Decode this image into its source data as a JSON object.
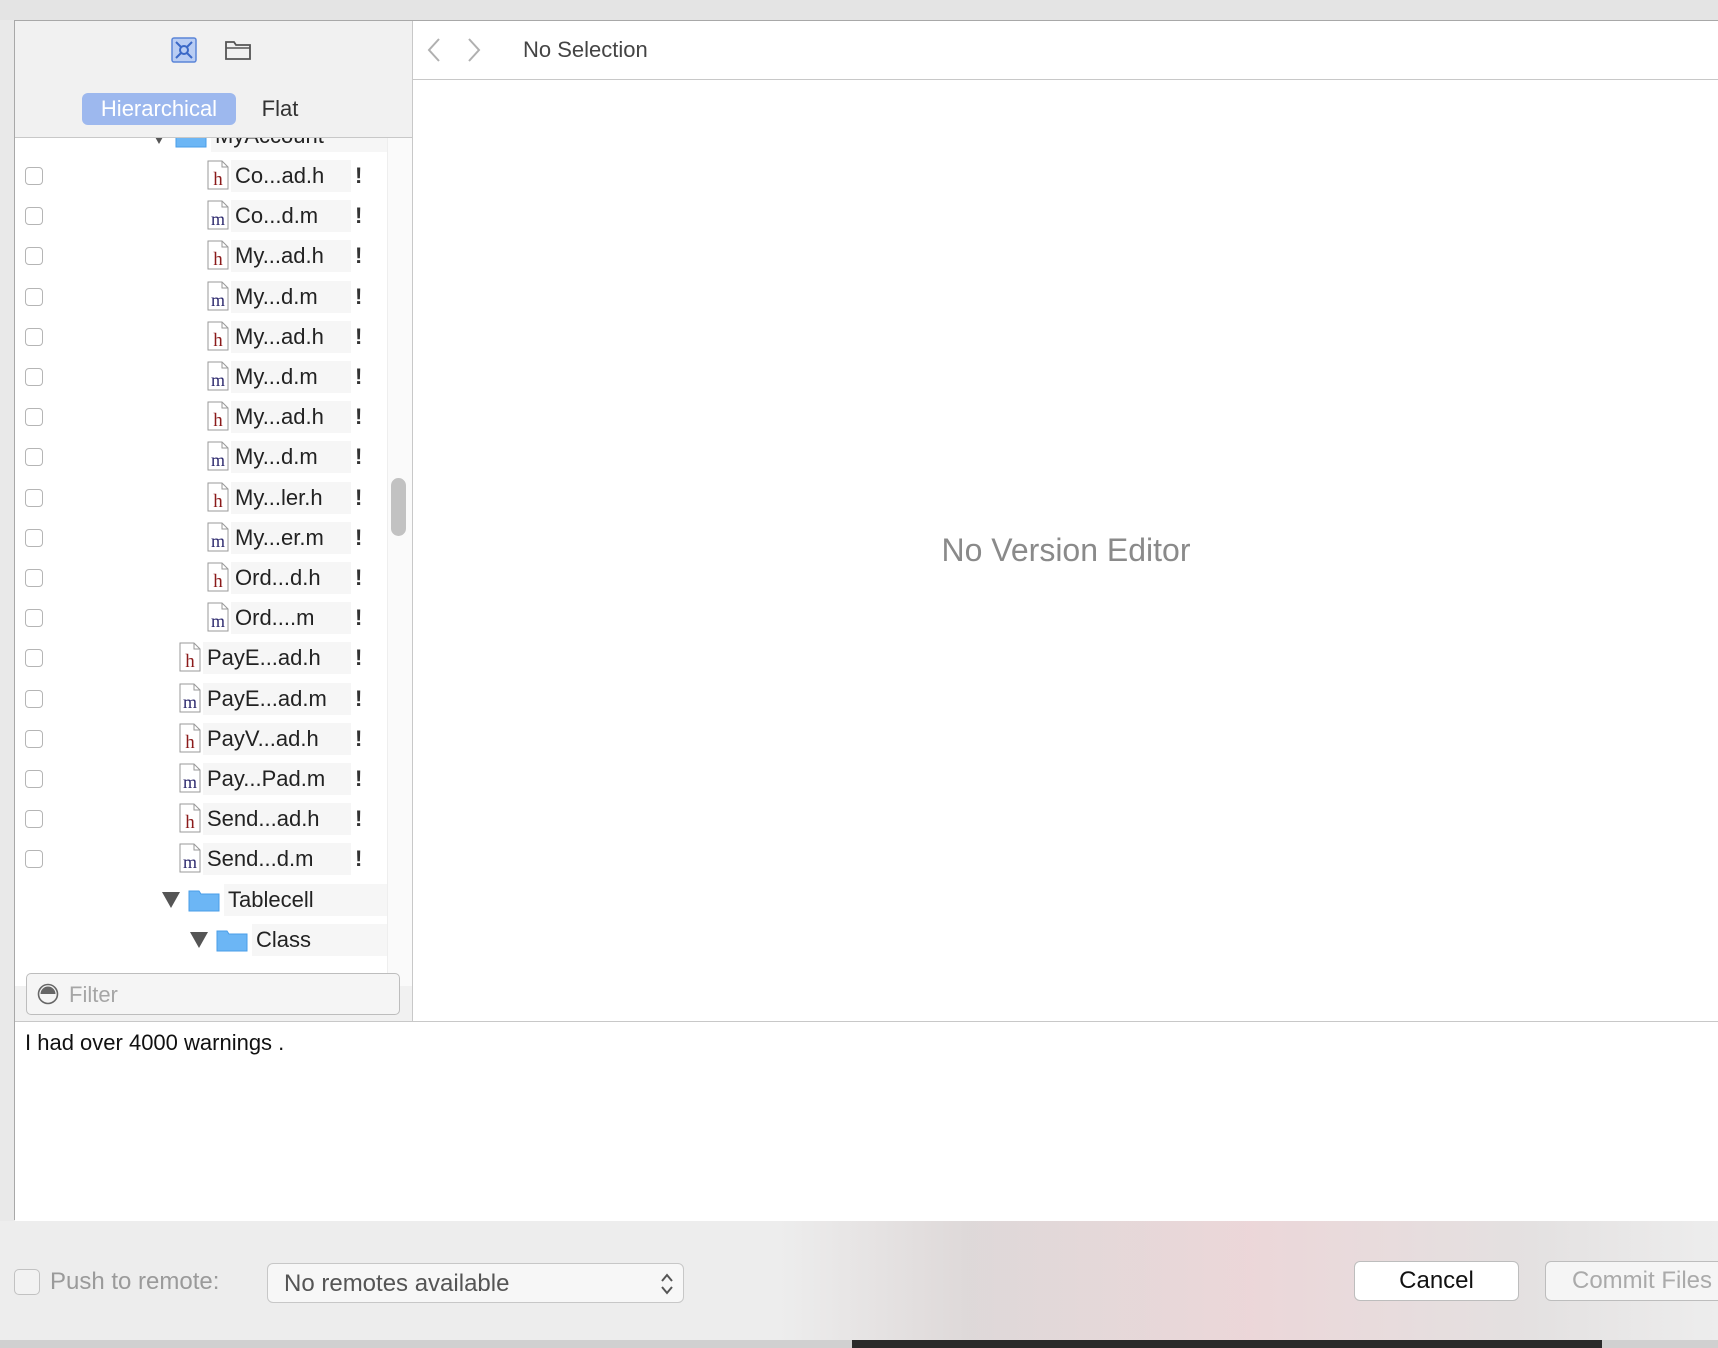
{
  "sidebar": {
    "toolbar": {
      "icon_a": "source-control-icon",
      "icon_b": "folder-icon"
    },
    "segments": [
      "Hierarchical",
      "Flat"
    ],
    "active_segment": "Hierarchical",
    "top_folder": "MyAccount",
    "files": [
      {
        "type": "h",
        "name": "Co...ad.h",
        "level": 3
      },
      {
        "type": "m",
        "name": "Co...d.m",
        "level": 3
      },
      {
        "type": "h",
        "name": "My...ad.h",
        "level": 3
      },
      {
        "type": "m",
        "name": "My...d.m",
        "level": 3
      },
      {
        "type": "h",
        "name": "My...ad.h",
        "level": 3
      },
      {
        "type": "m",
        "name": "My...d.m",
        "level": 3
      },
      {
        "type": "h",
        "name": "My...ad.h",
        "level": 3
      },
      {
        "type": "m",
        "name": "My...d.m",
        "level": 3
      },
      {
        "type": "h",
        "name": "My...ler.h",
        "level": 3
      },
      {
        "type": "m",
        "name": "My...er.m",
        "level": 3
      },
      {
        "type": "h",
        "name": "Ord...d.h",
        "level": 3
      },
      {
        "type": "m",
        "name": "Ord....m",
        "level": 3
      },
      {
        "type": "h",
        "name": "PayE...ad.h",
        "level": 2
      },
      {
        "type": "m",
        "name": "PayE...ad.m",
        "level": 2
      },
      {
        "type": "h",
        "name": "PayV...ad.h",
        "level": 2
      },
      {
        "type": "m",
        "name": "Pay...Pad.m",
        "level": 2
      },
      {
        "type": "h",
        "name": "Send...ad.h",
        "level": 2
      },
      {
        "type": "m",
        "name": "Send...d.m",
        "level": 2
      }
    ],
    "status_mark": "!",
    "folders": [
      {
        "name": "Tablecell",
        "level": 1
      },
      {
        "name": "Class",
        "level": 2
      }
    ],
    "filter_placeholder": "Filter"
  },
  "editor": {
    "nav_title": "No Selection",
    "placeholder": "No Version Editor"
  },
  "commit": {
    "message": "I had over 4000 warnings ."
  },
  "bottom": {
    "push_label": "Push to remote:",
    "remote_select": "No remotes available",
    "cancel_label": "Cancel",
    "commit_label": "Commit Files"
  },
  "colors": {
    "segment_active": "#9db8ee",
    "folder_blue": "#6cb6f5",
    "h_letter": "#8b1a1a",
    "m_letter": "#2d2a6e"
  }
}
